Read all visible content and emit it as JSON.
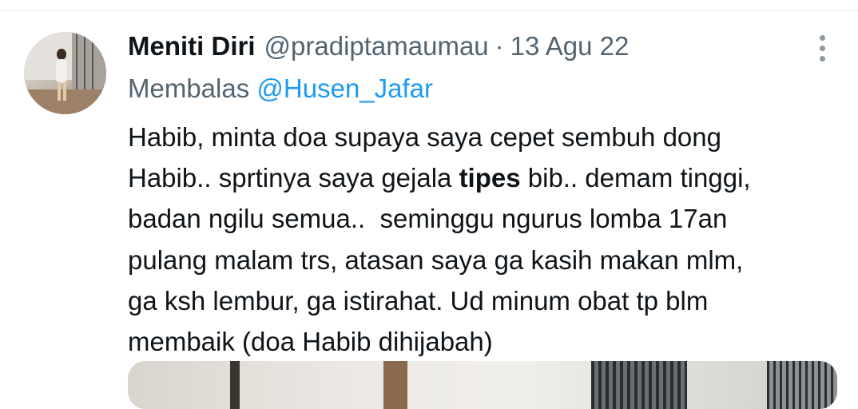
{
  "tweet": {
    "display_name": "Meniti Diri",
    "handle": "@pradiptamaumau",
    "separator": "·",
    "date": "13 Agu 22",
    "reply_prefix": "Membalas",
    "reply_to": "@Husen_Jafar",
    "text_lines": [
      {
        "before": "Habib, minta doa supaya saya cepet sembuh dong",
        "bold": "",
        "after": ""
      },
      {
        "before": "Habib.. sprtinya saya gejala ",
        "bold": "tipes",
        "after": " bib.. demam tinggi,"
      },
      {
        "before": "badan ngilu semua..  seminggu ngurus lomba 17an",
        "bold": "",
        "after": ""
      },
      {
        "before": "pulang malam trs, atasan saya ga kasih makan mlm,",
        "bold": "",
        "after": ""
      },
      {
        "before": "ga ksh lembur, ga istirahat. Ud minum obat tp blm",
        "bold": "",
        "after": ""
      },
      {
        "before": "membaik (doa Habib dihijabah)",
        "bold": "",
        "after": ""
      }
    ]
  },
  "icons": {
    "more": "more-vertical-icon"
  },
  "colors": {
    "primary_text": "#0f1419",
    "secondary_text": "#536471",
    "mention": "#1d9bf0",
    "more_icon": "#8b98a5"
  }
}
